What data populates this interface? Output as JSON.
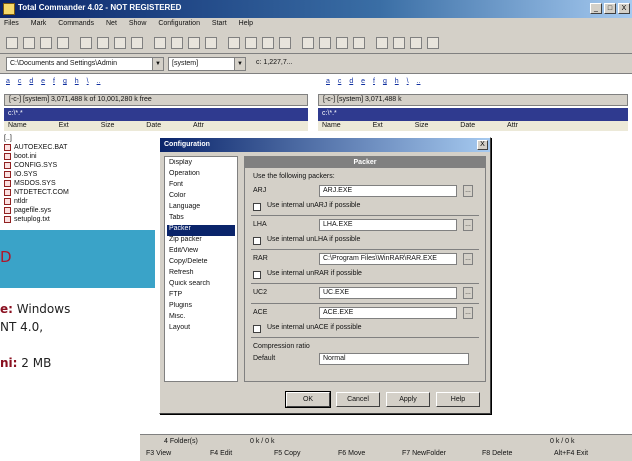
{
  "window": {
    "title": "Total Commander 4.02 - NOT REGISTERED",
    "buttons": [
      "_",
      "□",
      "X"
    ]
  },
  "menu": [
    "Files",
    "Mark",
    "Commands",
    "Net",
    "Show",
    "Configuration",
    "Start",
    "Help"
  ],
  "toolbar": {
    "icons": [
      "refresh-icon",
      "brief-icon",
      "full-icon",
      "tree-icon",
      "sort-name-icon",
      "sort-ext-icon",
      "sort-time-icon",
      "sort-size-icon",
      "unsorted-icon",
      "invert-icon",
      "back-icon",
      "forward-icon",
      "pack-icon",
      "unpack-icon",
      "search-icon",
      "rename-icon",
      "ftp-icon",
      "ftp-new-icon",
      "url-icon",
      "sync-icon",
      "compare-icon",
      "copy-names-icon",
      "notepad-icon",
      "help-icon"
    ]
  },
  "address": {
    "left_combo": "C:\\Documents and Settings\\Admin",
    "mid_combo": "[system]",
    "right_label": "c: 1,227,7..."
  },
  "left_panel": {
    "drives": [
      "a",
      "c",
      "d",
      "e",
      "f",
      "g",
      "h",
      "\\",
      ".."
    ],
    "path": "[-c-] [system] 3,071,488 k of 10,001,280 k free",
    "header": "c:\\*.*",
    "columns": [
      "Name",
      "Ext",
      "Size",
      "Date",
      "Attr"
    ],
    "files": [
      "[..]",
      "AUTOEXEC.BAT",
      "boot.ini",
      "CONFIG.SYS",
      "IO.SYS",
      "MSDOS.SYS",
      "NTDETECT.COM",
      "ntldr",
      "pagefile.sys",
      "setuplog.txt"
    ]
  },
  "right_panel": {
    "drives": [
      "a",
      "c",
      "d",
      "e",
      "f",
      "g",
      "h",
      "\\",
      ".."
    ],
    "path": "[-c-] [system] 3,071,488 k",
    "header": "c:\\*.*",
    "columns": [
      "Name",
      "Ext",
      "Size",
      "Date",
      "Attr"
    ]
  },
  "dialog": {
    "title": "Configuration",
    "close": "X",
    "categories": [
      "Display",
      "Operation",
      "Font",
      "Color",
      "Language",
      "Tabs",
      "Packer",
      "Zip packer",
      "Edit/View",
      "Copy/Delete",
      "Refresh",
      "Quick search",
      "FTP",
      "Plugins",
      "Misc.",
      "Layout"
    ],
    "selected_category": "Packer",
    "panel_title": "Packer",
    "labels": {
      "l1": "Use the following packers:",
      "l2": "ARJ",
      "l3": "ARJ.EXE",
      "l4": "Use internal unARJ if possible",
      "l5": "LHA",
      "l6": "LHA.EXE",
      "l7": "Use internal unLHA if possible",
      "l8": "RAR",
      "l9": "C:\\Program Files\\WinRAR\\RAR.EXE",
      "l10": "Use internal unRAR if possible",
      "l11": "UC2",
      "l12": "UC.EXE",
      "l13": "ACE",
      "l14": "ACE.EXE",
      "l15": "Use internal unACE if possible",
      "l16": "Compression ratio",
      "l17": "Default",
      "l18": "Normal"
    },
    "buttons": [
      "OK",
      "Cancel",
      "Apply",
      "Help"
    ]
  },
  "overlay": {
    "heading": "D",
    "lines": [
      {
        "label": "e:",
        "text": " Windows"
      },
      {
        "label": "",
        "text": "NT 4.0,"
      },
      {
        "label": "",
        "text": ""
      },
      {
        "label": "ni:",
        "text": " 2 MB"
      }
    ]
  },
  "statusbar": {
    "row1": [
      "4 Folder(s)",
      "0 k / 0 k",
      "0 k / 0 k"
    ],
    "row2": [
      "F3 View",
      "F4 Edit",
      "F5 Copy",
      "F6 Move",
      "F7 NewFolder",
      "F8 Delete",
      "Alt+F4 Exit"
    ]
  }
}
